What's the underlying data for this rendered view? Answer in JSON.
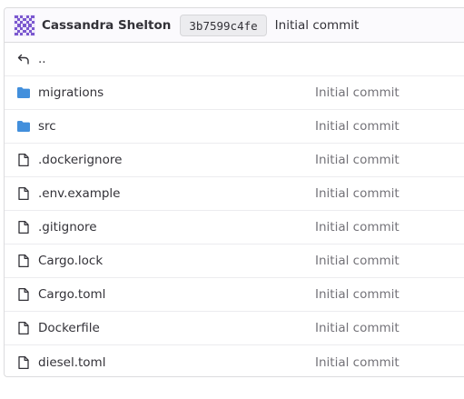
{
  "commit": {
    "author": "Cassandra Shelton",
    "sha": "3b7599c4fe",
    "message": "Initial commit"
  },
  "parent_row": {
    "icon": "return-arrow-icon",
    "label": ".."
  },
  "files": [
    {
      "name": "migrations",
      "type": "folder",
      "icon": "folder-icon",
      "last_commit": "Initial commit"
    },
    {
      "name": "src",
      "type": "folder",
      "icon": "folder-icon",
      "last_commit": "Initial commit"
    },
    {
      "name": ".dockerignore",
      "type": "file",
      "icon": "file-icon",
      "last_commit": "Initial commit"
    },
    {
      "name": ".env.example",
      "type": "file",
      "icon": "file-icon",
      "last_commit": "Initial commit"
    },
    {
      "name": ".gitignore",
      "type": "file",
      "icon": "file-icon",
      "last_commit": "Initial commit"
    },
    {
      "name": "Cargo.lock",
      "type": "file",
      "icon": "file-icon",
      "last_commit": "Initial commit"
    },
    {
      "name": "Cargo.toml",
      "type": "file",
      "icon": "file-icon",
      "last_commit": "Initial commit"
    },
    {
      "name": "Dockerfile",
      "type": "file",
      "icon": "file-icon",
      "last_commit": "Initial commit"
    },
    {
      "name": "diesel.toml",
      "type": "file",
      "icon": "file-icon",
      "last_commit": "Initial commit"
    }
  ],
  "colors": {
    "folder": "#428fdc",
    "avatar": "#7b58cf",
    "text": "#333238",
    "muted": "#737278"
  }
}
